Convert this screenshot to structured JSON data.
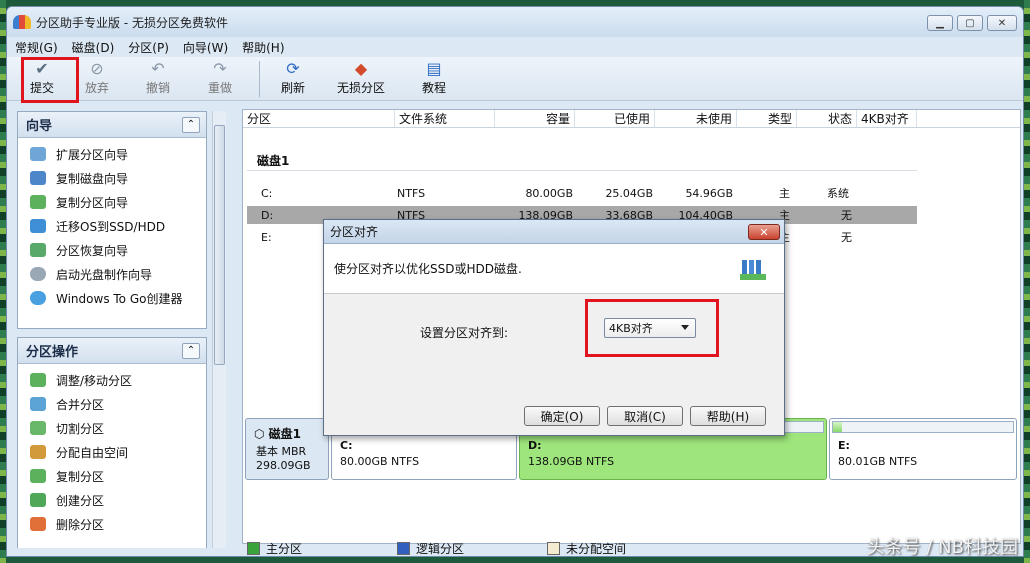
{
  "window": {
    "title": "分区助手专业版 - 无损分区免费软件",
    "min": "▁",
    "max": "▢",
    "close": "✕"
  },
  "menu": [
    "常规(G)",
    "磁盘(D)",
    "分区(P)",
    "向导(W)",
    "帮助(H)"
  ],
  "toolbar": [
    {
      "label": "提交",
      "icon": "checkmark-icon"
    },
    {
      "label": "放弃",
      "icon": "discard-icon"
    },
    {
      "label": "撤销",
      "icon": "undo-icon"
    },
    {
      "label": "重做",
      "icon": "redo-icon"
    },
    {
      "label": "刷新",
      "icon": "refresh-icon"
    },
    {
      "label": "无损分区",
      "icon": "partition-icon"
    },
    {
      "label": "教程",
      "icon": "tutorial-icon"
    }
  ],
  "wizard_panel": {
    "title": "向导",
    "items": [
      "扩展分区向导",
      "复制磁盘向导",
      "复制分区向导",
      "迁移OS到SSD/HDD",
      "分区恢复向导",
      "启动光盘制作向导",
      "Windows To Go创建器"
    ]
  },
  "ops_panel": {
    "title": "分区操作",
    "items": [
      "调整/移动分区",
      "合并分区",
      "切割分区",
      "分配自由空间",
      "复制分区",
      "创建分区",
      "删除分区"
    ]
  },
  "table": {
    "headers": [
      "分区",
      "文件系统",
      "容量",
      "已使用",
      "未使用",
      "类型",
      "状态",
      "4KB对齐"
    ],
    "disk_label": "磁盘1",
    "rows": [
      [
        "C:",
        "NTFS",
        "80.00GB",
        "25.04GB",
        "54.96GB",
        "主",
        "系统"
      ],
      [
        "D:",
        "NTFS",
        "138.09GB",
        "33.68GB",
        "104.40GB",
        "主",
        "无"
      ],
      [
        "E:",
        "",
        "",
        "",
        "",
        "主",
        "无"
      ]
    ]
  },
  "dialog": {
    "title": "分区对齐",
    "close": "✕",
    "description": "使分区对齐以优化SSD或HDD磁盘.",
    "label": "设置分区对齐到:",
    "selected": "4KB对齐",
    "ok": "确定(O)",
    "cancel": "取消(C)",
    "help": "帮助(H)"
  },
  "diskmap": {
    "disk": {
      "name": "磁盘1",
      "type": "基本 MBR",
      "size": "298.09GB"
    },
    "parts": [
      {
        "name": "C:",
        "info": "80.00GB NTFS",
        "used": 0.31
      },
      {
        "name": "D:",
        "info": "138.09GB NTFS",
        "used": 0.24
      },
      {
        "name": "E:",
        "info": "80.01GB NTFS",
        "used": 0.05
      }
    ]
  },
  "legend": [
    "主分区",
    "逻辑分区",
    "未分配空间"
  ],
  "colors": {
    "primary": "#3aa33a",
    "logical": "#2f5fbf",
    "unallocated": "#f5ecd0",
    "highlight": "#e0141e",
    "selected_part": "#9ee67c"
  },
  "watermark": "头条号 / NB科技园"
}
